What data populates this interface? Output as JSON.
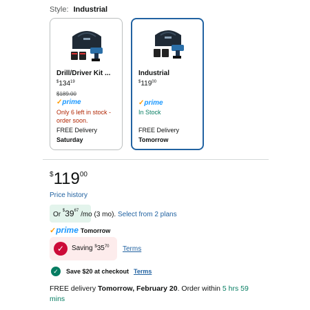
{
  "style": {
    "label": "Style:",
    "value": "Industrial"
  },
  "options": [
    {
      "title": "Drill/Driver Kit ...",
      "price_symbol": "$",
      "price_whole": "134",
      "price_fraction": "19",
      "list_price": "$189.00",
      "prime": "prime",
      "stock": "Only 6 left in stock - order soon.",
      "delivery_label": "FREE Delivery",
      "delivery_date": "Saturday"
    },
    {
      "title": "Industrial",
      "price_symbol": "$",
      "price_whole": "119",
      "price_fraction": "00",
      "prime": "prime",
      "stock": "In Stock",
      "delivery_label": "FREE Delivery",
      "delivery_date": "Tomorrow"
    }
  ],
  "buybox": {
    "price_symbol": "$",
    "price_whole": "119",
    "price_fraction": "00",
    "price_history": "Price history",
    "plan_or": "Or",
    "plan_symbol": "$",
    "plan_whole": "39",
    "plan_fraction": "67",
    "plan_period": "/mo (3 mo).",
    "plan_link": "Select from 2 plans",
    "prime": "prime",
    "prime_delivery": "Tomorrow",
    "saving_label": "Saving",
    "saving_symbol": "$",
    "saving_whole": "35",
    "saving_fraction": "70",
    "terms": "Terms",
    "coupon": "Save $20 at checkout",
    "coupon_terms": "Terms",
    "delivery_prefix": "FREE delivery",
    "delivery_date": "Tomorrow, February 20",
    "delivery_mid": ". Order within",
    "delivery_countdown": "5 hrs 59 mins"
  },
  "colors": {
    "link": "#2162a1",
    "selected_border": "#2162a1",
    "prime_blue": "#1a98ff",
    "prime_check": "#ff9900",
    "low_stock": "#b12704",
    "in_stock": "#067d62",
    "saving_badge": "#cc0c39"
  }
}
